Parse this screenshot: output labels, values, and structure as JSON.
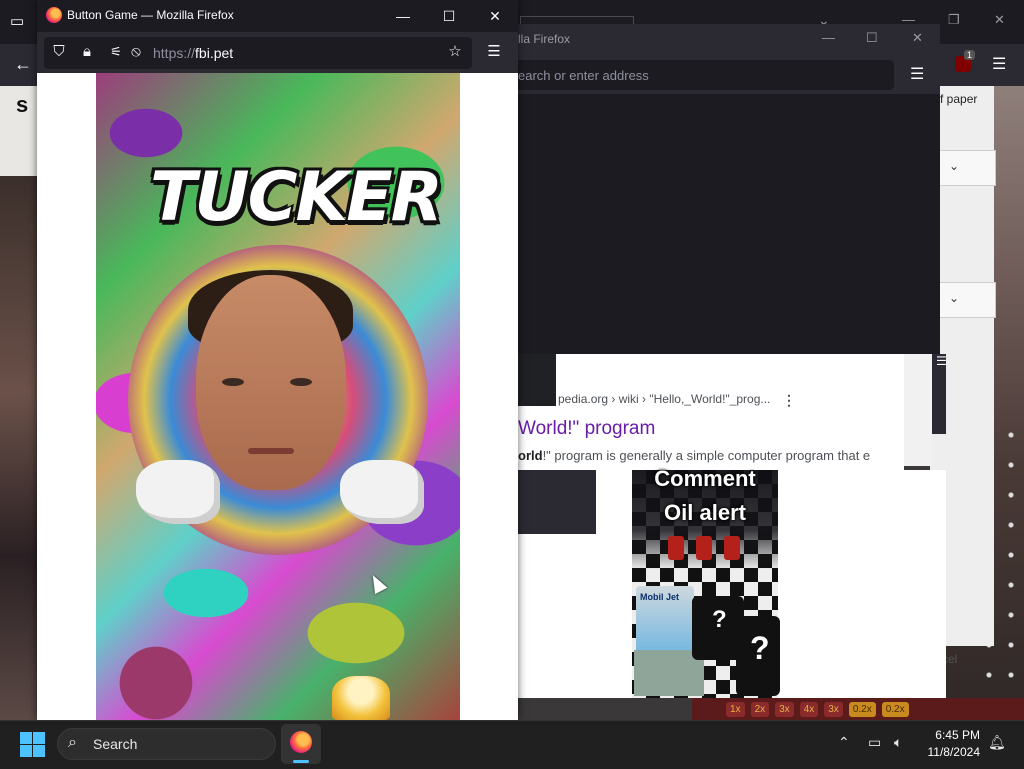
{
  "main_window": {
    "title": "Button Game — Mozilla Firefox",
    "url_scheme": "https://",
    "url_host": "fbi.pet",
    "controls": {
      "minimize": "—",
      "maximize": "☐",
      "close": "✕"
    },
    "page": {
      "heading": "TUCKER"
    }
  },
  "background_window": {
    "title_fragment": "lla Firefox",
    "address_placeholder": "earch or enter address",
    "side_text": "f paper",
    "cancel_text": "cel",
    "ublock_badge": "1"
  },
  "search_result": {
    "breadcrumb": "pedia.org › wiki › \"Hello,_World!\"_prog...",
    "title": "World!\" program",
    "description_bold": "orld",
    "description_rest": "!\" program is generally a simple computer program that e"
  },
  "video": {
    "caption_line1": "Comment",
    "caption_line2": "Oil alert",
    "can_label": "Mobil Jet",
    "mystery_mark": "?"
  },
  "bet_row": [
    "1x",
    "2x",
    "3x",
    "4x",
    "3x",
    "0.2x",
    "0.2x"
  ],
  "taskbar": {
    "search_label": "Search",
    "time": "6:45 PM",
    "date": "11/8/2024"
  },
  "colors": {
    "firefox_dark": "#1c1b22",
    "firefox_toolbar": "#2b2a33",
    "taskbar": "#202020",
    "windows_accent": "#4cc2ff",
    "link_visited": "#681da8"
  }
}
